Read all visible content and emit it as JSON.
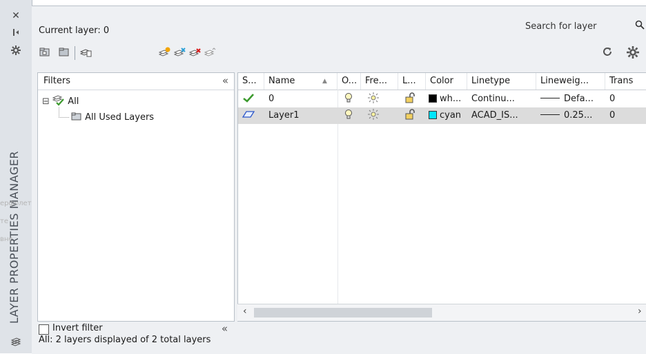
{
  "palette": {
    "title_strip": "#dfe3e8",
    "panel_bg": "#eef0f3",
    "selected_row": "#dcdcdc",
    "checkmark": "#3c9a2e",
    "cyan": "#00e5ff",
    "white_swatch": "#000000"
  },
  "side_strip": {
    "title": "LAYER PROPERTIES MANAGER",
    "buttons": [
      "close-icon",
      "pin-icon",
      "settings-icon"
    ],
    "bottom_icon": "layers-icon",
    "ghost_text": [
      "ерфолет",
      "те",
      "вне"
    ]
  },
  "header": {
    "current_layer": "Current layer: 0",
    "search_placeholder": "Search for layer",
    "search_icon": "magnifier-icon"
  },
  "toolbar": {
    "icons": [
      "new-property-filter-icon",
      "new-group-filter-icon",
      "layer-states-manager-icon",
      "new-layer-icon",
      "new-layer-vp-frozen-icon",
      "delete-layer-icon",
      "set-current-icon"
    ],
    "right_icons": [
      "refresh-icon",
      "settings-icon"
    ]
  },
  "filters": {
    "header": "Filters",
    "collapse_glyph": "«",
    "tree": [
      {
        "label": "All",
        "expand": "⊟",
        "icon": "all-filter-icon"
      },
      {
        "label": "All Used Layers",
        "icon": "used-layers-filter-icon"
      }
    ],
    "invert_label": "Invert filter",
    "invert_checked": false
  },
  "status_line": "All: 2 layers displayed of 2 total layers",
  "grid": {
    "columns": [
      "S...",
      "Name",
      "O...",
      "Fre...",
      "L...",
      "Color",
      "Linetype",
      "Lineweig...",
      "Trans"
    ],
    "sort_glyph": "▲",
    "rows": [
      {
        "status": "current-check-icon",
        "name": "0",
        "on": "bulb-on-icon",
        "freeze": "sun-thawed-icon",
        "lock": "unlocked-icon",
        "color_swatch": "#000000",
        "color": "wh...",
        "linetype": "Continu...",
        "lineweight": "Defa...",
        "transparency": "0",
        "selected": false
      },
      {
        "status": "layer-parallelogram-icon",
        "name": "Layer1",
        "on": "bulb-on-icon",
        "freeze": "sun-thawed-icon",
        "lock": "unlocked-icon",
        "color_swatch": "#00e5ff",
        "color": "cyan",
        "linetype": "ACAD_IS...",
        "lineweight": "0.25...",
        "transparency": "0",
        "selected": true
      }
    ]
  },
  "scrollbar": {
    "left_arrow": "‹",
    "right_arrow": "›"
  }
}
